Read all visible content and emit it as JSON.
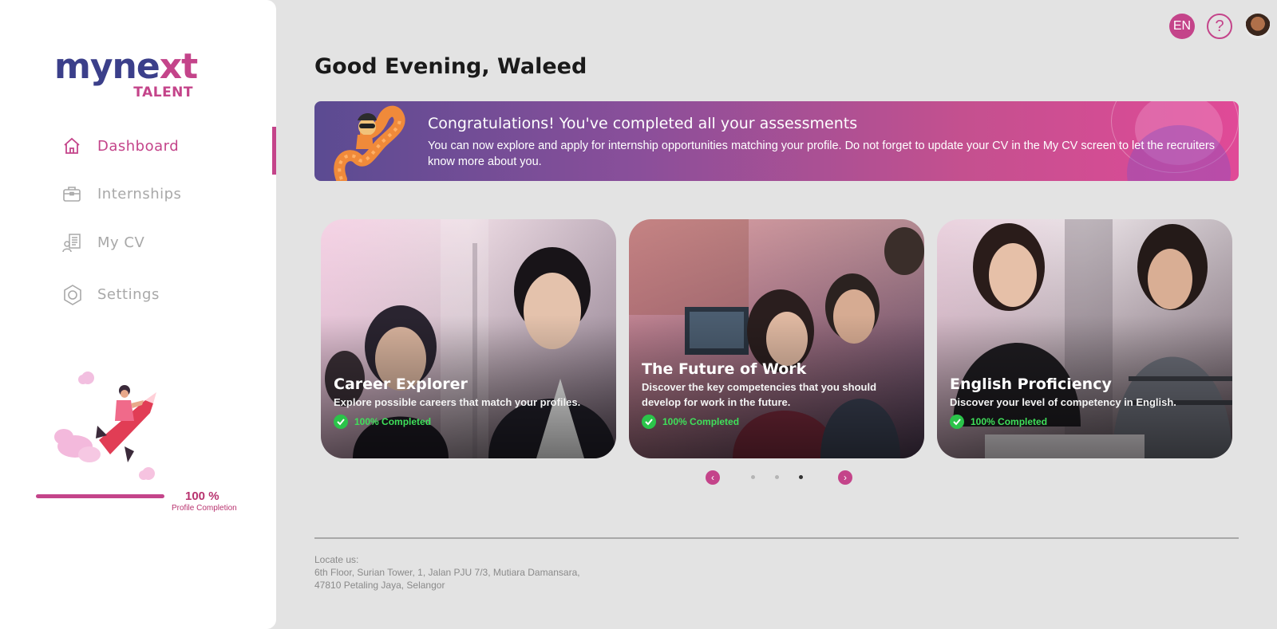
{
  "app": {
    "logo_main": "mynext",
    "logo_sub": "TALENT"
  },
  "sidebar": {
    "items": [
      {
        "label": "Dashboard",
        "icon": "home-icon",
        "active": true
      },
      {
        "label": "Internships",
        "icon": "briefcase-icon",
        "active": false
      },
      {
        "label": "My CV",
        "icon": "cv-document-icon",
        "active": false
      },
      {
        "label": "Settings",
        "icon": "gear-icon",
        "active": false
      }
    ],
    "profile": {
      "percent_label": "100 %",
      "caption": "Profile Completion",
      "progress": 1.0
    }
  },
  "header": {
    "language": "EN",
    "help": "?"
  },
  "main": {
    "greeting": "Good Evening, Waleed",
    "banner": {
      "title": "Congratulations! You've completed all your assessments",
      "text": "You can now explore and apply for internship opportunities matching your profile. Do not forget to update your CV in the My CV screen to let the recruiters know more about you."
    },
    "cards": [
      {
        "title": "Career Explorer",
        "description": "Explore possible careers that match your profiles.",
        "status": "100% Completed"
      },
      {
        "title": "The Future of Work",
        "description": "Discover the key competencies that you should develop for work in the future.",
        "status": "100% Completed"
      },
      {
        "title": "English Proficiency",
        "description": "Discover your level of competency in English.",
        "status": "100% Completed"
      }
    ],
    "carousel": {
      "pages": 3,
      "active_page": 3
    }
  },
  "footer": {
    "heading": "Locate us:",
    "line1": "6th Floor, Surian Tower, 1, Jalan PJU 7/3, Mutiara Damansara,",
    "line2": "47810 Petaling Jaya, Selangor"
  },
  "colors": {
    "accent": "#c4448a",
    "background": "#e3e3e3",
    "status_green": "#3fe05a"
  }
}
